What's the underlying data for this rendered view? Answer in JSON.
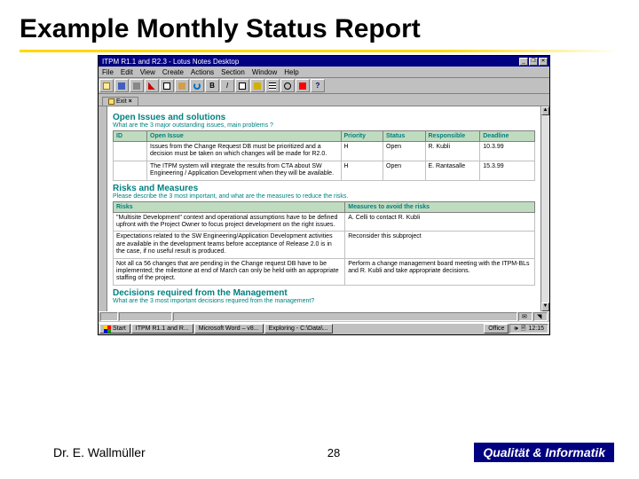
{
  "slide": {
    "title": "Example Monthly Status Report",
    "author": "Dr. E. Wallmüller",
    "page_number": "28",
    "brand": "Qualität & Informatik"
  },
  "window": {
    "title": "ITPM R1.1 and R2.3 - Lotus Notes Desktop",
    "minimize": "_",
    "maximize": "❐",
    "close": "✕"
  },
  "menubar": [
    "File",
    "Edit",
    "View",
    "Create",
    "Actions",
    "Section",
    "Window",
    "Help"
  ],
  "tab": {
    "label": "Exit",
    "close_glyph": "×"
  },
  "sections": {
    "open_issues": {
      "heading": "Open Issues and solutions",
      "subtext": "What are the 3 major outstanding issues, main problems ?",
      "columns": [
        "ID",
        "Open Issue",
        "Priority",
        "Status",
        "Responsible",
        "Deadline"
      ],
      "rows": [
        {
          "id": "",
          "issue": "Issues from the Change Request DB must be prioritized and a decision must be taken on which changes will be made for R2.0.",
          "priority": "H",
          "status": "Open",
          "responsible": "R. Kubli",
          "deadline": "10.3.99"
        },
        {
          "id": "",
          "issue": "The ITPM system will integrate the results from CTA about SW Engineering / Application Development when they will be available.",
          "priority": "H",
          "status": "Open",
          "responsible": "E. Rantasalle",
          "deadline": "15.3.99"
        }
      ]
    },
    "risks": {
      "heading": "Risks and Measures",
      "subtext": "Please describe the 3 most important, and what are the measures to reduce the risks.",
      "columns": [
        "Risks",
        "Measures to avoid the risks"
      ],
      "rows": [
        {
          "risk": "\"Multisite Development\" context and operational assumptions have to be defined upfront with the Project Owner to focus project development on the right issues.",
          "measure": "A. Celli to contact R. Kubli"
        },
        {
          "risk": "Expectations related to the SW Engineering/Application Development activities are available in the development teams before acceptance of Release 2.0 is in the case, if no useful result is produced.",
          "measure": "Reconsider this subproject"
        },
        {
          "risk": "Not all ca 56 changes that are pending in the Change request DB have to be implemented; the milestone at end of March can only be held with an appropriate staffing of the project.",
          "measure": "Perform a change management board meeting with the ITPM-BLs and R. Kubli and take appropriate decisions."
        }
      ]
    },
    "decisions": {
      "heading": "Decisions required from the Management",
      "subtext": "What are the 3 most important decisions required from the management?"
    }
  },
  "taskbar": {
    "start": "Start",
    "tasks": [
      "ITPM R1.1 and R...",
      "Microsoft Word – v8...",
      "Exploring - C:\\Data\\..."
    ],
    "tray_office": "Office",
    "tray_time": "12:15"
  }
}
